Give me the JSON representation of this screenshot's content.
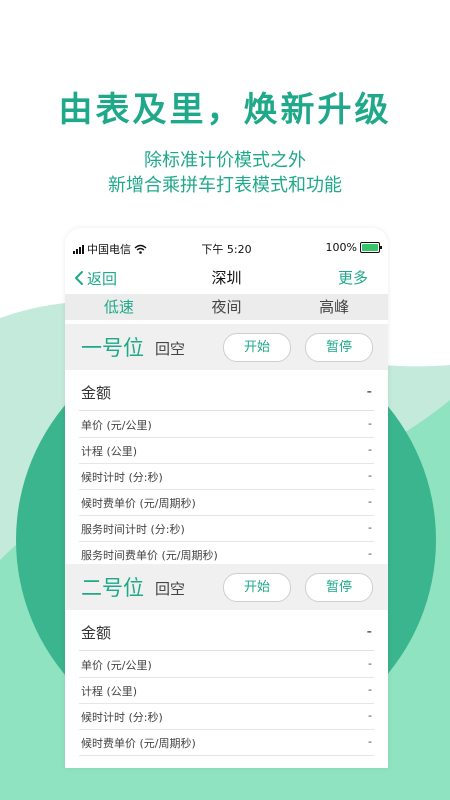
{
  "hero": {
    "title": "由表及里，焕新升级",
    "subtitle_line1": "除标准计价模式之外",
    "subtitle_line2": "新增合乘拼车打表模式和功能"
  },
  "status_bar": {
    "carrier": "中国电信",
    "time": "下午 5:20",
    "battery_text": "100%",
    "battery_level": 1.0
  },
  "nav": {
    "back_label": "返回",
    "title": "深圳",
    "more_label": "更多"
  },
  "modes": [
    {
      "label": "低速",
      "active": true
    },
    {
      "label": "夜间",
      "active": false
    },
    {
      "label": "高峰",
      "active": false
    }
  ],
  "seat1": {
    "name": "一号位",
    "state": "回空",
    "start_label": "开始",
    "pause_label": "暂停",
    "amount": {
      "label": "金额",
      "value": "-"
    },
    "rows": [
      {
        "label": "单价 (元/公里)",
        "value": "-"
      },
      {
        "label": "计程 (公里)",
        "value": "-"
      },
      {
        "label": "候时计时 (分:秒)",
        "value": "-"
      },
      {
        "label": "候时费单价 (元/周期秒)",
        "value": "-"
      },
      {
        "label": "服务时间计时 (分:秒)",
        "value": "-"
      },
      {
        "label": "服务时间费单价 (元/周期秒)",
        "value": "-"
      }
    ]
  },
  "seat2": {
    "name": "二号位",
    "state": "回空",
    "start_label": "开始",
    "pause_label": "暂停",
    "amount": {
      "label": "金额",
      "value": "-"
    },
    "rows": [
      {
        "label": "单价 (元/公里)",
        "value": "-"
      },
      {
        "label": "计程 (公里)",
        "value": "-"
      },
      {
        "label": "候时计时 (分:秒)",
        "value": "-"
      },
      {
        "label": "候时费单价 (元/周期秒)",
        "value": "-"
      }
    ]
  },
  "colors": {
    "accent": "#1fa98a",
    "wave_light": "#c4eadb",
    "wave_mid": "#8fe3c0",
    "circle": "#3ab58e"
  }
}
